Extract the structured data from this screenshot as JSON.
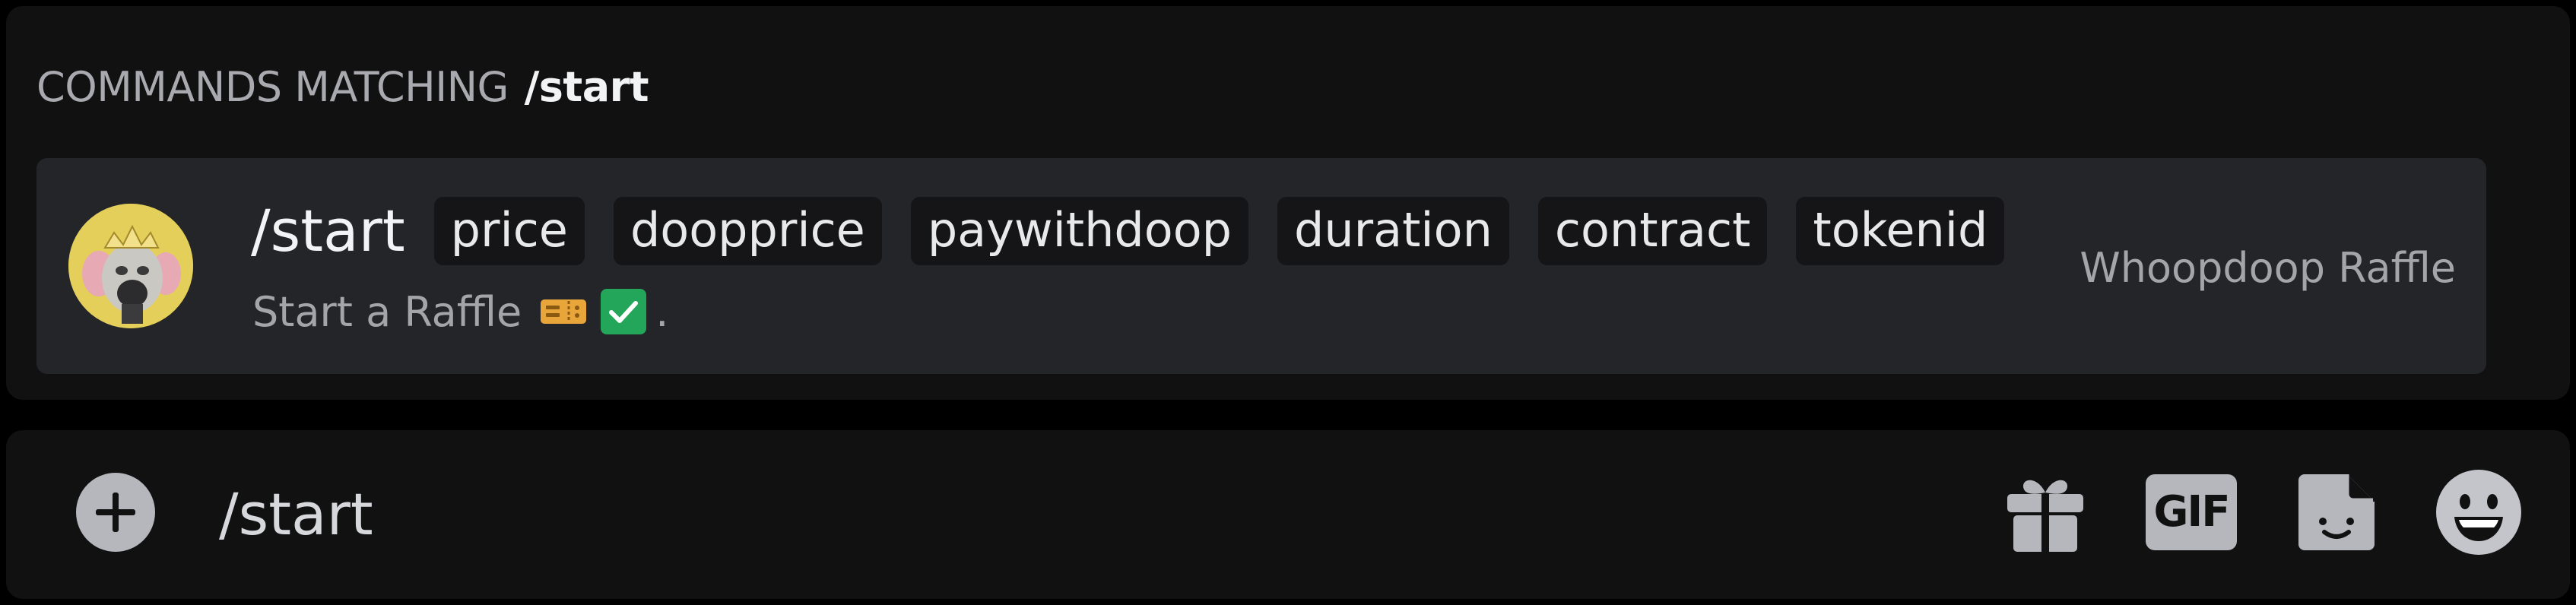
{
  "autocomplete": {
    "header_prefix": "COMMANDS MATCHING",
    "header_query": "/start",
    "command": {
      "name": "/start",
      "options": [
        "price",
        "doopprice",
        "paywithdoop",
        "duration",
        "contract",
        "tokenid"
      ],
      "description": "Start a Raffle",
      "description_suffix": ".",
      "description_emojis": [
        "ticket-emoji",
        "check-mark-emoji"
      ],
      "source": "Whoopdoop Raffle"
    }
  },
  "composer": {
    "value": "/start",
    "tools": [
      "gift-icon",
      "gif-icon",
      "sticker-icon",
      "emoji-icon"
    ],
    "gif_label": "GIF"
  },
  "colors": {
    "panel_bg": "#111112",
    "row_bg": "#242528",
    "option_bg": "#151517",
    "icon_gray": "#b5b7bc",
    "check_green": "#23a55a",
    "ticket_orange": "#e8a53a"
  }
}
